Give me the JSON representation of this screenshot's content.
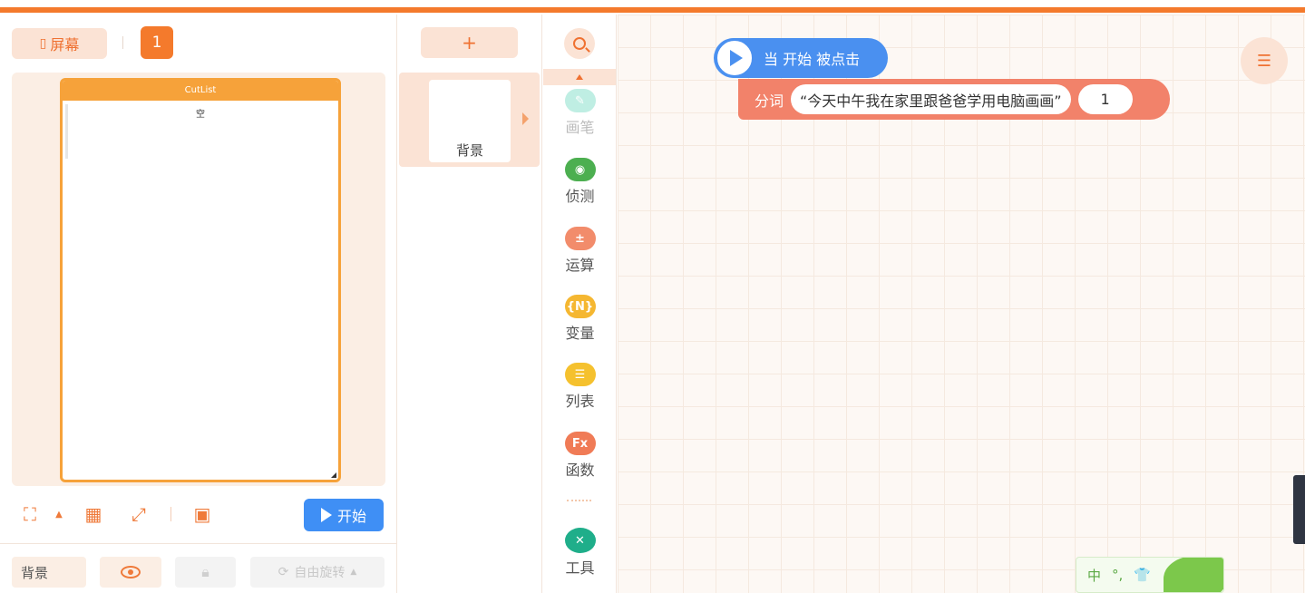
{
  "header": {
    "accent": "#f47a2c"
  },
  "stage": {
    "screen_label": "屏幕",
    "screen_icon": "phone-icon",
    "page_number": "1",
    "device_title": "CutList",
    "device_empty_text": "空",
    "tools": [
      "fit-screen-icon",
      "grid-icon",
      "fullscreen-icon",
      "preview-icon"
    ],
    "start_label": "开始"
  },
  "properties": {
    "target_label": "背景",
    "rotate_label": "自由旋转"
  },
  "sprites": {
    "add_label": "+",
    "items": [
      {
        "name": "背景"
      }
    ]
  },
  "categories": [
    {
      "label": "画笔",
      "icon": "pen-icon",
      "color": "#4fc9b0"
    },
    {
      "label": "侦测",
      "icon": "sensor-icon",
      "color": "#4caf50"
    },
    {
      "label": "运算",
      "icon": "operator-icon",
      "color": "#f28c6b"
    },
    {
      "label": "变量",
      "icon": "variable-icon",
      "color": "#f5b731"
    },
    {
      "label": "列表",
      "icon": "list-icon",
      "color": "#f5c12e"
    },
    {
      "label": "函数",
      "icon": "function-icon",
      "color": "#f07b56"
    },
    {
      "label": "工具",
      "icon": "tools-icon",
      "color": "#1fae8a"
    }
  ],
  "workspace": {
    "hat_label": "当 开始 被点击",
    "cmd_label": "分词",
    "cmd_string": "“今天中午我在家里跟爸爸学用电脑画画”",
    "cmd_number": "1"
  },
  "ime": {
    "mode": "中",
    "punct": "°,",
    "skin": "👕"
  }
}
